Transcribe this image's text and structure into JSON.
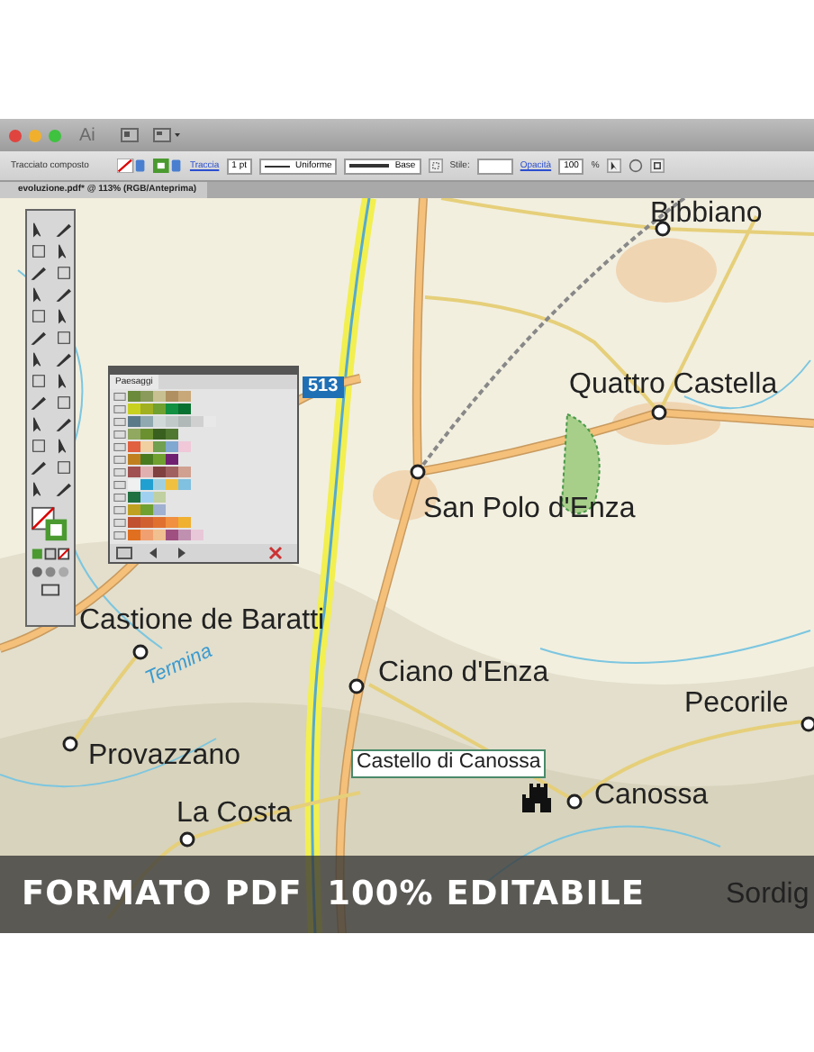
{
  "window": {
    "app_badge": "Ai"
  },
  "control_bar": {
    "object_type": "Tracciato composto",
    "stroke_label": "Traccia",
    "stroke_weight": "1 pt",
    "profile": "Uniforme",
    "brush": "Base",
    "style_label": "Stile:",
    "opacity_label": "Opacità",
    "opacity": "100",
    "percent": "%"
  },
  "document_tab": {
    "title": "evoluzione.pdf* @ 113% (RGB/Anteprima)"
  },
  "swatches_panel": {
    "tab": "Paesaggi",
    "groups": [
      {
        "swatches": [
          {
            "color": "#6b8a3a"
          },
          {
            "color": "#8a9a5a"
          },
          {
            "color": "#c8c090"
          },
          {
            "color": "#b09060"
          },
          {
            "color": "#c8a878"
          }
        ]
      },
      {
        "swatches": [
          {
            "color": "#c8d020"
          },
          {
            "color": "#a0b020"
          },
          {
            "color": "#70a030"
          },
          {
            "color": "#109040"
          },
          {
            "color": "#087030"
          }
        ]
      },
      {
        "swatches": [
          {
            "color": "#5a7a8a"
          },
          {
            "color": "#90a8b0"
          },
          {
            "color": "#d0d8d8"
          },
          {
            "color": "#c0c8c8"
          },
          {
            "color": "#b0b8b8"
          },
          {
            "color": "#d0d0d0"
          },
          {
            "color": "#e8e8e8"
          }
        ]
      },
      {
        "swatches": [
          {
            "color": "#90a860"
          },
          {
            "color": "#6a9030"
          },
          {
            "color": "#3a6020"
          },
          {
            "color": "#507830"
          }
        ]
      },
      {
        "swatches": [
          {
            "color": "#e06040"
          },
          {
            "color": "#f0d0a0"
          },
          {
            "color": "#70a050"
          },
          {
            "color": "#80a8d0"
          },
          {
            "color": "#f0c8d8"
          }
        ]
      },
      {
        "swatches": [
          {
            "color": "#c08020"
          },
          {
            "color": "#4a7a20"
          },
          {
            "color": "#70a030"
          },
          {
            "color": "#702070"
          }
        ]
      },
      {
        "swatches": [
          {
            "color": "#a05050"
          },
          {
            "color": "#e0b0b0"
          },
          {
            "color": "#804040"
          },
          {
            "color": "#a06060"
          },
          {
            "color": "#d0a090"
          }
        ]
      },
      {
        "swatches": [
          {
            "color": "#f0f0f0"
          },
          {
            "color": "#20a0d0"
          },
          {
            "color": "#a0d0e0"
          },
          {
            "color": "#f0c040"
          },
          {
            "color": "#80c0e0"
          }
        ]
      },
      {
        "swatches": [
          {
            "color": "#207040"
          },
          {
            "color": "#a0d0f0"
          },
          {
            "color": "#c0d0a0"
          }
        ]
      },
      {
        "swatches": [
          {
            "color": "#c0a020"
          },
          {
            "color": "#70a030"
          },
          {
            "color": "#a0b0d0"
          }
        ]
      },
      {
        "swatches": [
          {
            "color": "#c05030"
          },
          {
            "color": "#d06030"
          },
          {
            "color": "#e07030"
          },
          {
            "color": "#f09040"
          },
          {
            "color": "#f0b030"
          }
        ]
      },
      {
        "swatches": [
          {
            "color": "#e07020"
          },
          {
            "color": "#f0a070"
          },
          {
            "color": "#f0c090"
          },
          {
            "color": "#a05080"
          },
          {
            "color": "#c090b0"
          },
          {
            "color": "#e8c8d8"
          }
        ]
      }
    ]
  },
  "map": {
    "labels": [
      {
        "text": "Bibbiano",
        "kind": "town"
      },
      {
        "text": "513",
        "kind": "road_number"
      },
      {
        "text": "Quattro Castella",
        "kind": "town"
      },
      {
        "text": "San Polo d'Enza",
        "kind": "town"
      },
      {
        "text": "Castione de Baratti",
        "kind": "town"
      },
      {
        "text": "Termina",
        "kind": "river"
      },
      {
        "text": "Ciano d'Enza",
        "kind": "town"
      },
      {
        "text": "Pecorile",
        "kind": "town"
      },
      {
        "text": "Provazzano",
        "kind": "town"
      },
      {
        "text": "Castello di Canossa",
        "kind": "landmark"
      },
      {
        "text": "Canossa",
        "kind": "town"
      },
      {
        "text": "La Costa",
        "kind": "town"
      },
      {
        "text": "Sordig",
        "kind": "town"
      }
    ]
  },
  "banner": {
    "text": "FORMATO PDF  100% EDITABILE"
  }
}
